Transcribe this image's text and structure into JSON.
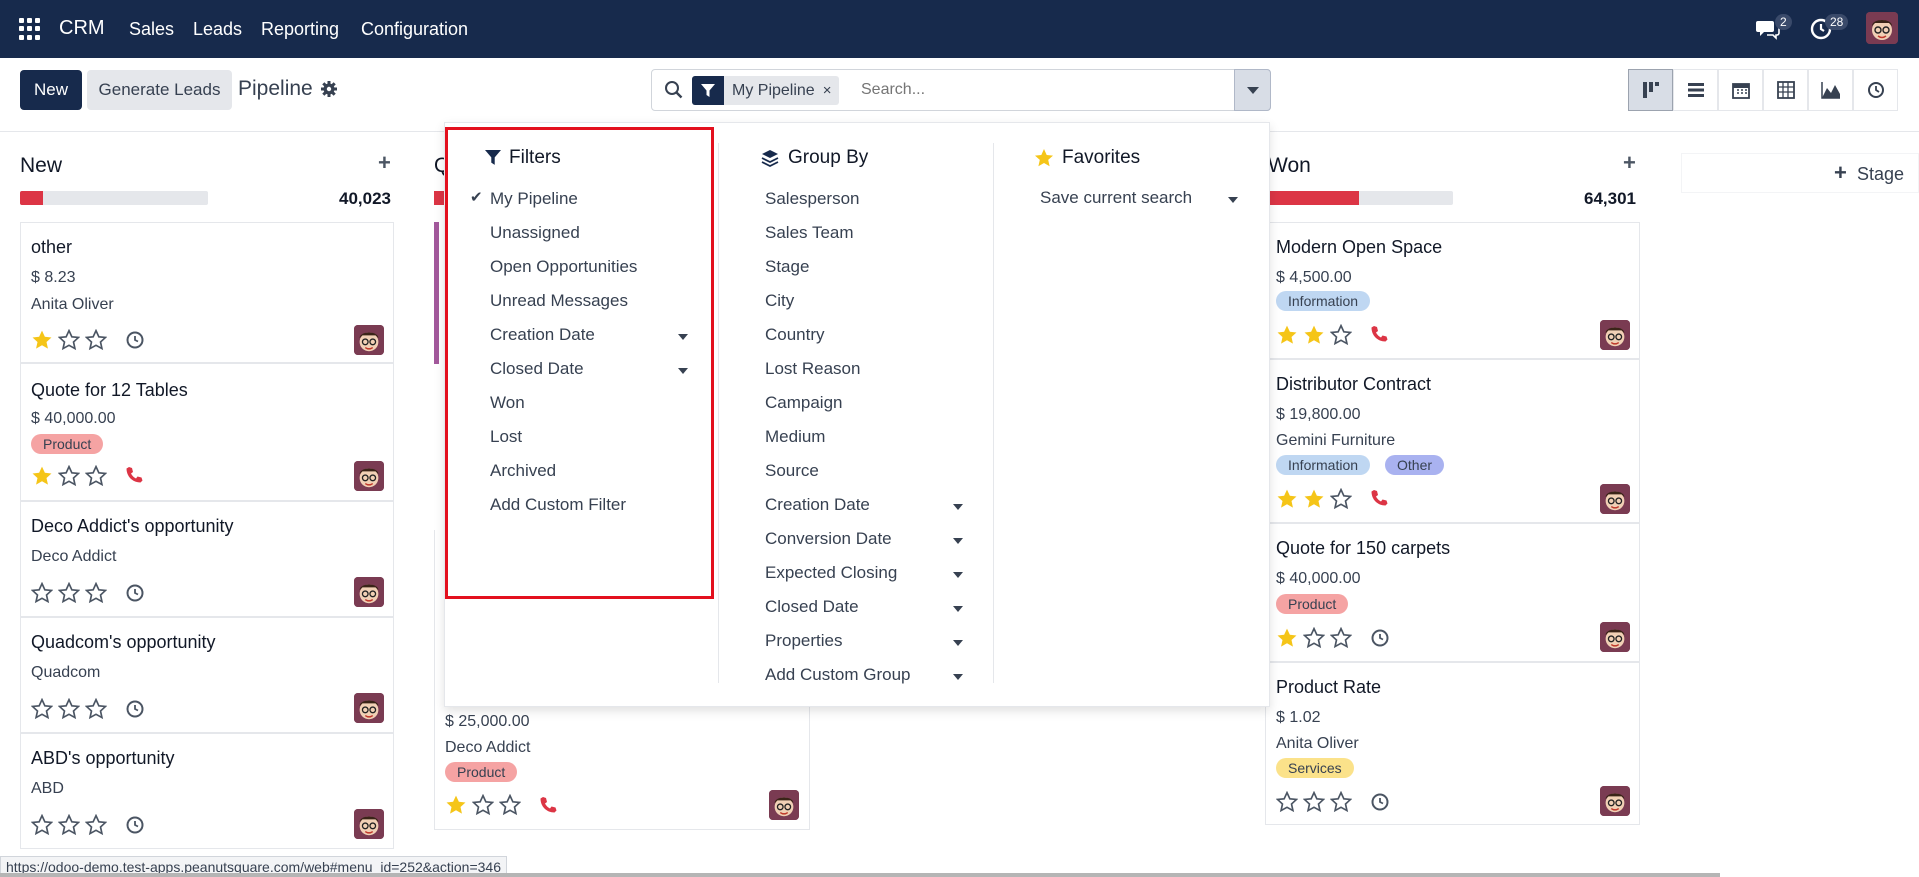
{
  "topbar": {
    "app": "CRM",
    "menus": [
      "Sales",
      "Leads",
      "Reporting",
      "Configuration"
    ],
    "messages_count": "2",
    "activities_count": "28"
  },
  "control": {
    "new_label": "New",
    "generate_label": "Generate Leads",
    "title": "Pipeline",
    "facet_label": "My Pipeline",
    "search_placeholder": "Search..."
  },
  "columns": [
    {
      "name": "New",
      "total": "40,023",
      "progress": 0.12
    },
    {
      "name": "Won",
      "total": "64,301",
      "progress": 0.49
    }
  ],
  "cards_new": [
    {
      "title": "other",
      "amount": "$ 8.23",
      "customer": "Anita Oliver",
      "stars": 1,
      "activity": "clock"
    },
    {
      "title": "Quote for 12 Tables",
      "amount": "$ 40,000.00",
      "tag": "Product",
      "stars": 1,
      "activity": "phone"
    },
    {
      "title": "Deco Addict's opportunity",
      "customer": "Deco Addict",
      "stars": 0,
      "activity": "clock"
    },
    {
      "title": "Quadcom's opportunity",
      "customer": "Quadcom",
      "stars": 0,
      "activity": "clock"
    },
    {
      "title": "ABD's opportunity",
      "customer": "ABD",
      "stars": 0,
      "activity": "clock"
    }
  ],
  "card_mid": {
    "col_initial": "Q",
    "amount": "$ 25,000.00",
    "customer": "Deco Addict",
    "tag": "Product",
    "stars": 1,
    "activity": "phone"
  },
  "cards_won": [
    {
      "title": "Modern Open Space",
      "amount": "$ 4,500.00",
      "tags": [
        "Information"
      ],
      "stars": 2,
      "activity": "phone"
    },
    {
      "title": "Distributor Contract",
      "amount": "$ 19,800.00",
      "customer": "Gemini Furniture",
      "tags": [
        "Information",
        "Other"
      ],
      "stars": 2,
      "activity": "phone"
    },
    {
      "title": "Quote for 150 carpets",
      "amount": "$ 40,000.00",
      "tags": [
        "Product"
      ],
      "stars": 1,
      "activity": "clock"
    },
    {
      "title": "Product Rate",
      "amount": "$ 1.02",
      "customer": "Anita Oliver",
      "tags": [
        "Services"
      ],
      "stars": 0,
      "activity": "clock"
    }
  ],
  "stage_label": "Stage",
  "filters": {
    "heading": "Filters",
    "items": [
      "My Pipeline",
      "Unassigned",
      "Open Opportunities",
      "Unread Messages",
      "Creation Date",
      "Closed Date",
      "Won",
      "Lost",
      "Archived",
      "Add Custom Filter"
    ]
  },
  "groupby": {
    "heading": "Group By",
    "items": [
      "Salesperson",
      "Sales Team",
      "Stage",
      "City",
      "Country",
      "Lost Reason",
      "Campaign",
      "Medium",
      "Source",
      "Creation Date",
      "Conversion Date",
      "Expected Closing",
      "Closed Date",
      "Properties",
      "Add Custom Group"
    ]
  },
  "favorites": {
    "heading": "Favorites",
    "save_label": "Save current search"
  },
  "status_url": "https://odoo-demo.test-apps.peanutsquare.com/web#menu_id=252&action=346",
  "colors": {
    "navbar": "#172a4c",
    "star": "#f5c518",
    "phone": "#dc3545",
    "highlight": "#e3101e"
  }
}
